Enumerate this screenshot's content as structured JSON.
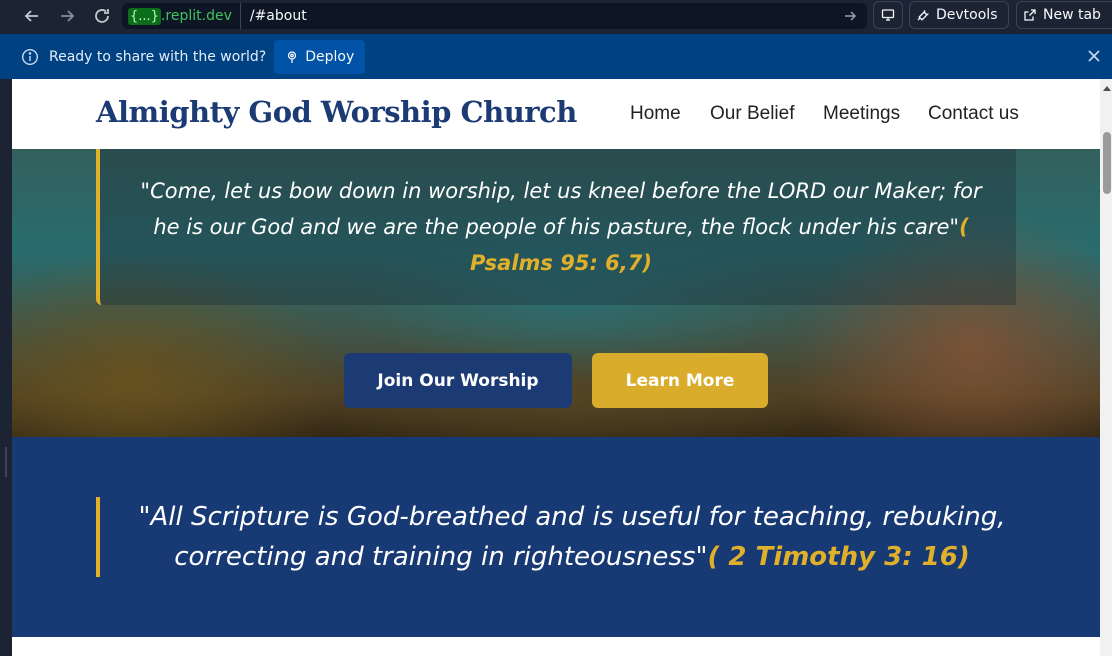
{
  "browser": {
    "host_brace": "{...}",
    "host_domain": ".replit.dev",
    "path": "/#about",
    "devtools_label": "Devtools",
    "newtab_label": "New tab"
  },
  "banner": {
    "message": "Ready to share with the world?",
    "deploy_label": "Deploy"
  },
  "site": {
    "logo": "Almighty God Worship Church",
    "nav": [
      "Home",
      "Our Belief",
      "Meetings",
      "Contact us"
    ]
  },
  "hero": {
    "quote": "\"Come, let us bow down in worship, let us kneel before the LORD our Maker; for he is our God and we are the people of his pasture, the flock under his care\"",
    "reference": "( Psalms 95: 6,7)",
    "primary_button": "Join Our Worship",
    "secondary_button": "Learn More"
  },
  "scripture": {
    "quote": "\"All Scripture is God-breathed and is useful for teaching, rebuking, correcting and training in righteousness\"",
    "reference": "( 2 Timothy 3: 16)"
  },
  "colors": {
    "brand_navy": "#1c3a74",
    "accent_gold": "#e0b02a",
    "banner_blue": "#004182"
  }
}
